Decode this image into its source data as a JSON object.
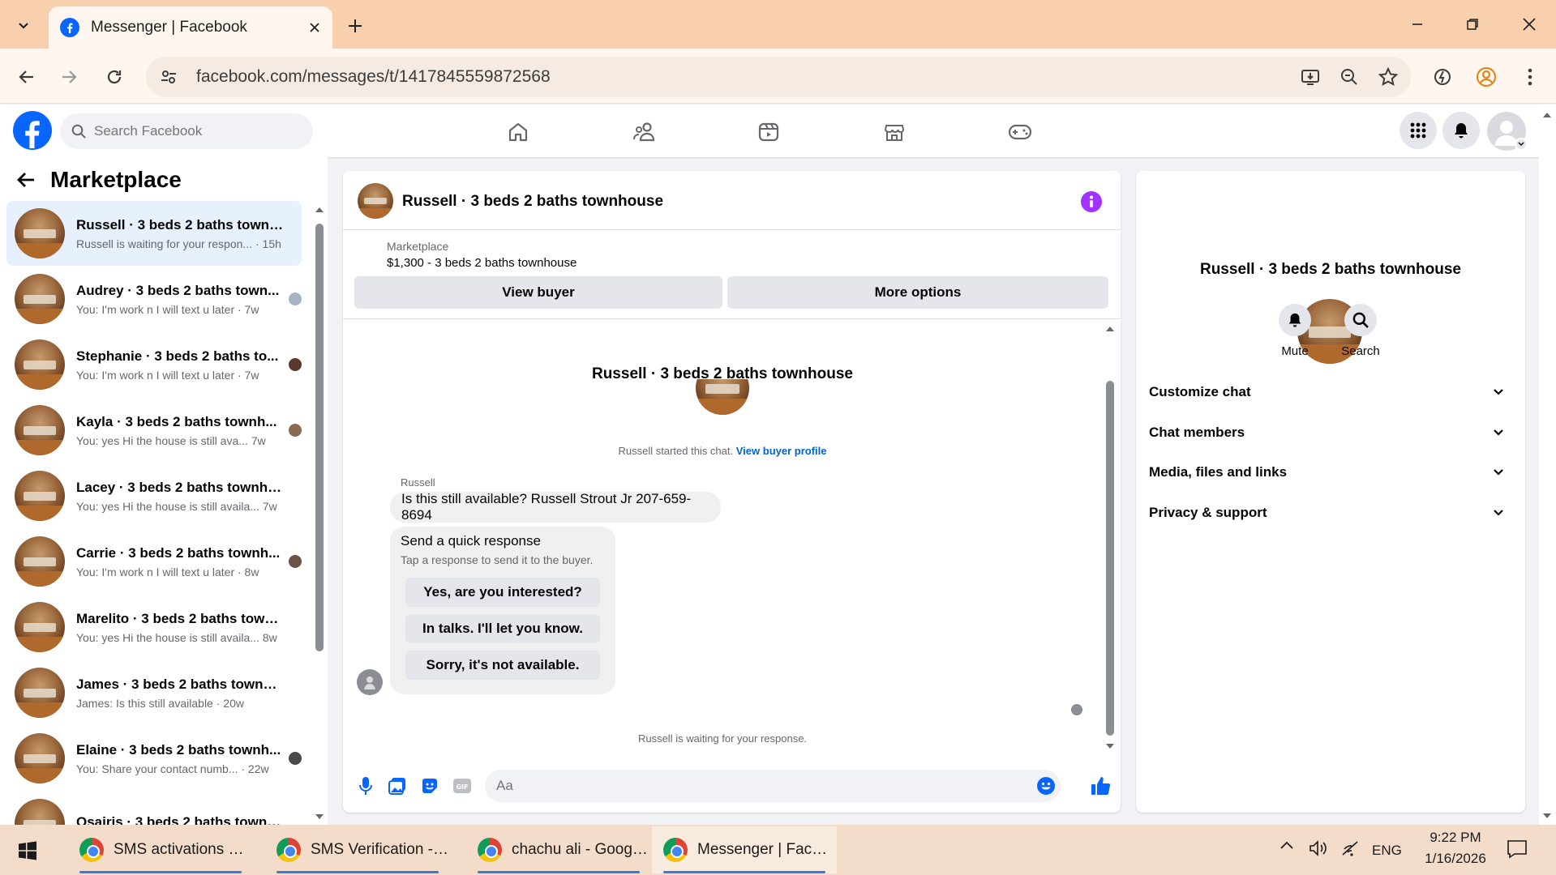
{
  "browser": {
    "tab_title": "Messenger | Facebook",
    "url": "facebook.com/messages/t/1417845559872568"
  },
  "fb": {
    "search_placeholder": "Search Facebook"
  },
  "left": {
    "title": "Marketplace",
    "conversations": [
      {
        "name": "Russell · 3 beds 2 baths townho...",
        "preview": "Russell is waiting for your respon... · 15h",
        "active": true,
        "read_color": ""
      },
      {
        "name": "Audrey · 3 beds 2 baths town...",
        "preview": "You: I'm work n I will text u later · 7w",
        "read_color": "#a8b3c2"
      },
      {
        "name": "Stephanie · 3 beds 2 baths to...",
        "preview": "You: I'm work n I will text u later · 7w",
        "read_color": "#5a3a2e"
      },
      {
        "name": "Kayla · 3 beds 2 baths townh...",
        "preview": "You: yes Hi the house is still ava... 7w",
        "read_color": "#8a6a55"
      },
      {
        "name": "Lacey · 3 beds 2 baths townhou...",
        "preview": "You: yes Hi the house is still availa... 7w",
        "read_color": ""
      },
      {
        "name": "Carrie · 3 beds 2 baths townh...",
        "preview": "You: I'm work n I will text u later · 8w",
        "read_color": "#6b5445"
      },
      {
        "name": "Marelito · 3 beds 2 baths townh...",
        "preview": "You: yes Hi the house is still availa... 8w",
        "read_color": ""
      },
      {
        "name": "James · 3 beds 2 baths townho...",
        "preview": "James: Is this still available · 20w",
        "read_color": ""
      },
      {
        "name": "Elaine · 3 beds 2 baths townh...",
        "preview": "You: Share your contact numb... · 22w",
        "read_color": "#4a4a4a"
      },
      {
        "name": "Osairis · 3 beds 2 baths townho...",
        "preview": "",
        "read_color": ""
      }
    ]
  },
  "chat": {
    "header_title": "Russell · 3 beds 2 baths townhouse",
    "listing_label": "Marketplace",
    "listing_title": "$1,300 - 3 beds 2 baths townhouse",
    "view_buyer": "View buyer",
    "more_options": "More options",
    "intro_name": "Russell · 3 beds 2 baths townhouse",
    "started_text": "Russell started this chat.",
    "view_profile": "View buyer profile",
    "sender": "Russell",
    "message": "Is this still available? Russell Strout Jr 207-659-8694",
    "quick_title": "Send a quick response",
    "quick_sub": "Tap a response to send it to the buyer.",
    "quick_responses": [
      "Yes, are you interested?",
      "In talks. I'll let you know.",
      "Sorry, it's not available."
    ],
    "waiting": "Russell is waiting for your response.",
    "composer_placeholder": "Aa"
  },
  "right": {
    "name": "Russell · 3 beds 2 baths townhouse",
    "mute": "Mute",
    "search": "Search",
    "rows": [
      "Customize chat",
      "Chat members",
      "Media, files and links",
      "Privacy & support"
    ]
  },
  "taskbar": {
    "items": [
      "SMS activations hist...",
      "SMS Verification - 9...",
      "chachu ali - Google ...",
      "Messenger | Facebo..."
    ],
    "lang": "ENG",
    "time": "9:22 PM",
    "date": "1/16/2026"
  },
  "colors": {
    "fb_blue": "#0866ff",
    "link_blue": "#0064d1",
    "info_purple": "#a033ff",
    "tabstrip": "#f8d0ad"
  }
}
